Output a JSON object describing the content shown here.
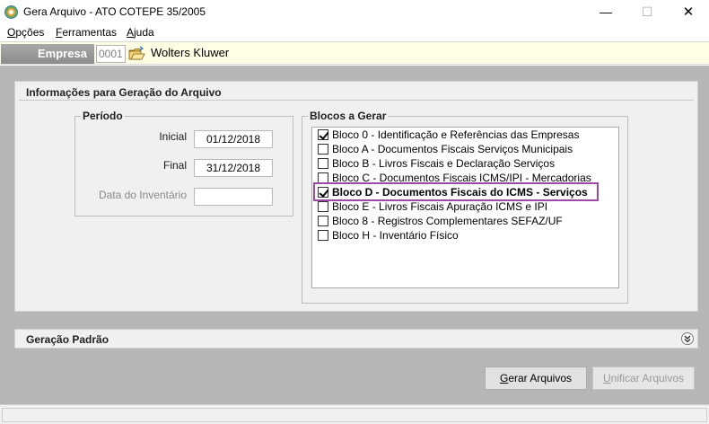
{
  "window": {
    "title": "Gera Arquivo - ATO COTEPE 35/2005",
    "minimize_glyph": "—",
    "maximize_glyph": "☐",
    "close_glyph": "✕"
  },
  "menu": [
    {
      "first": "O",
      "rest": "pções"
    },
    {
      "first": "F",
      "rest": "erramentas"
    },
    {
      "first": "A",
      "rest": "juda"
    }
  ],
  "empresa": {
    "label": "Empresa",
    "code": "0001",
    "name": "Wolters Kluwer"
  },
  "info_panel": {
    "title": "Informações para Geração do Arquivo",
    "periodo": {
      "title": "Período",
      "inicial_label": "Inicial",
      "inicial_value": "01/12/2018",
      "final_label": "Final",
      "final_value": "31/12/2018",
      "inventario_label": "Data do Inventário",
      "inventario_value": ""
    },
    "blocos": {
      "title": "Blocos a Gerar",
      "items": [
        {
          "label": "Bloco 0 - Identificação e Referências das Empresas",
          "checked": true
        },
        {
          "label": "Bloco A - Documentos Fiscais Serviços Municipais",
          "checked": false
        },
        {
          "label": "Bloco B - Livros Fiscais e Declaração Serviços",
          "checked": false
        },
        {
          "label": "Bloco C - Documentos Fiscais ICMS/IPI - Mercadorias",
          "checked": false
        },
        {
          "label": "Bloco D - Documentos Fiscais do ICMS - Serviços",
          "checked": true
        },
        {
          "label": "Bloco E - Livros Fiscais Apuração ICMS e IPI",
          "checked": false
        },
        {
          "label": "Bloco 8 - Registros Complementares SEFAZ/UF",
          "checked": false
        },
        {
          "label": "Bloco H - Inventário Físico",
          "checked": false
        }
      ]
    }
  },
  "geracao_panel": {
    "title": "Geração Padrão"
  },
  "buttons": {
    "gerar_first": "G",
    "gerar_rest": "erar Arquivos",
    "unificar_first": "U",
    "unificar_rest": "nificar Arquivos"
  },
  "colors": {
    "highlight": "#9b4ba3",
    "main_bg": "#b6b6b6",
    "empresa_bg": "#fffde4"
  }
}
